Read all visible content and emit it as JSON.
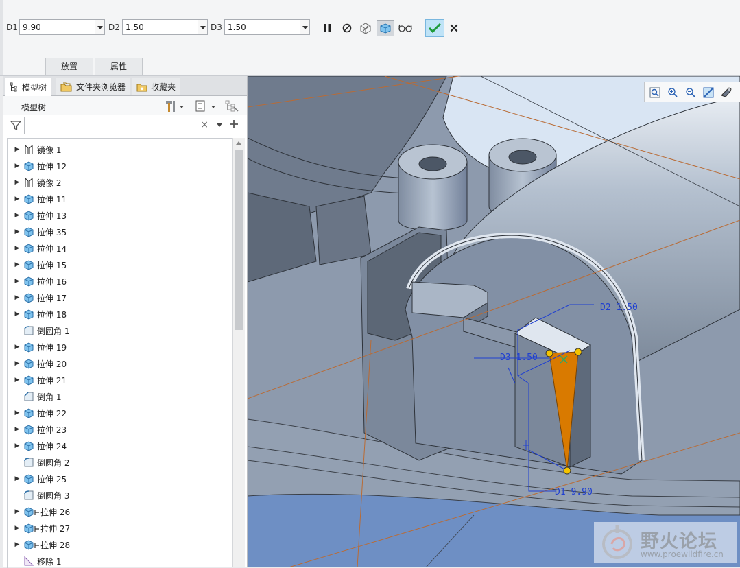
{
  "dashboard": {
    "d1": {
      "label": "D1",
      "value": "9.90"
    },
    "d2": {
      "label": "D2",
      "value": "1.50"
    },
    "d3": {
      "label": "D3",
      "value": "1.50"
    },
    "tab_placement": "放置",
    "tab_properties": "属性"
  },
  "panel": {
    "tab_model_tree": "模型树",
    "tab_folder_browser": "文件夹浏览器",
    "tab_favorites": "收藏夹",
    "header_title": "模型树",
    "search_clear": "×"
  },
  "tree": [
    {
      "icon": "mirror",
      "label": "镜像 1",
      "expand": true
    },
    {
      "icon": "extrude",
      "label": "拉伸 12",
      "expand": true
    },
    {
      "icon": "mirror",
      "label": "镜像 2",
      "expand": true
    },
    {
      "icon": "extrude",
      "label": "拉伸 11",
      "expand": true
    },
    {
      "icon": "extrude",
      "label": "拉伸 13",
      "expand": true
    },
    {
      "icon": "extrude",
      "label": "拉伸 35",
      "expand": true
    },
    {
      "icon": "extrude",
      "label": "拉伸 14",
      "expand": true
    },
    {
      "icon": "extrude",
      "label": "拉伸 15",
      "expand": true
    },
    {
      "icon": "extrude",
      "label": "拉伸 16",
      "expand": true
    },
    {
      "icon": "extrude",
      "label": "拉伸 17",
      "expand": true
    },
    {
      "icon": "extrude",
      "label": "拉伸 18",
      "expand": true
    },
    {
      "icon": "round",
      "label": "倒圆角 1",
      "expand": false
    },
    {
      "icon": "extrude",
      "label": "拉伸 19",
      "expand": true
    },
    {
      "icon": "extrude",
      "label": "拉伸 20",
      "expand": true
    },
    {
      "icon": "extrude",
      "label": "拉伸 21",
      "expand": true
    },
    {
      "icon": "chamfer",
      "label": "倒角 1",
      "expand": false
    },
    {
      "icon": "extrude",
      "label": "拉伸 22",
      "expand": true
    },
    {
      "icon": "extrude",
      "label": "拉伸 23",
      "expand": true
    },
    {
      "icon": "extrude",
      "label": "拉伸 24",
      "expand": true
    },
    {
      "icon": "round",
      "label": "倒圆角 2",
      "expand": false
    },
    {
      "icon": "extrude",
      "label": "拉伸 25",
      "expand": true
    },
    {
      "icon": "round",
      "label": "倒圆角 3",
      "expand": false
    },
    {
      "icon": "extrude-ref",
      "label": "拉伸 26",
      "expand": true
    },
    {
      "icon": "extrude-ref",
      "label": "拉伸 27",
      "expand": true
    },
    {
      "icon": "extrude-ref",
      "label": "拉伸 28",
      "expand": true
    },
    {
      "icon": "move",
      "label": "移除 1",
      "expand": false
    }
  ],
  "viewport": {
    "dim_d2": "D2 1.50",
    "dim_d3": "D3 1.50",
    "dim_d1": "D1 9.90",
    "watermark_title": "野火论坛",
    "watermark_url": "www.proewildfire.cn"
  },
  "colors": {
    "accent": "#1e7fd6",
    "rib": "#d97a00",
    "handle": "#f5c400",
    "confirm": "#1f9b3a"
  }
}
